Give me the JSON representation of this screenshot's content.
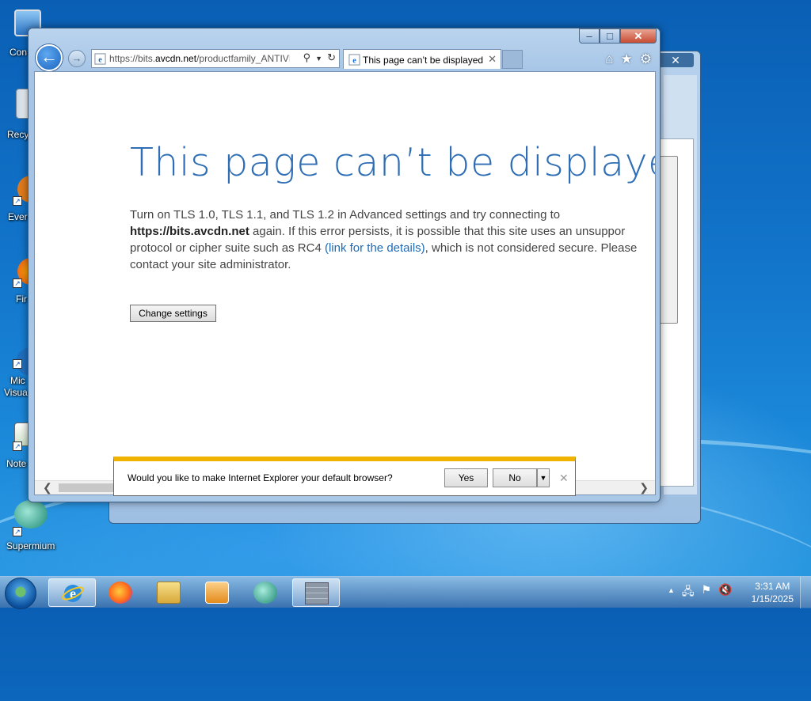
{
  "desktop": {
    "icons": [
      {
        "label": "Con"
      },
      {
        "label": "Recy"
      },
      {
        "label": "Ever"
      },
      {
        "label": "Fir"
      },
      {
        "label": "Mic"
      },
      {
        "label": "Visua"
      },
      {
        "label": "Note"
      },
      {
        "label": "Supermium"
      }
    ]
  },
  "browser": {
    "address_prefix": "https://bits.",
    "address_domain": "avcdn.net",
    "address_suffix": "/productfamily_ANTIVI",
    "tab_title": "This page can’t be displayed",
    "caption": {
      "minimize": "–",
      "maximize": "□",
      "close": "✕"
    },
    "back_symbol": "←",
    "forward_symbol": "→",
    "tab_close": "✕",
    "toolbar_icons": {
      "home": "⌂",
      "favorites": "★",
      "tools": "⚙"
    }
  },
  "error_page": {
    "heading": "This page can’t be displayed",
    "line1": "Turn on TLS 1.0, TLS 1.1, and TLS 1.2 in Advanced settings and try connecting to",
    "host": "https://bits.avcdn.net",
    "line2_rest": " again. If this error persists, it is possible that this site uses an unsuppor",
    "line3_start": "protocol or cipher suite such as RC4 ",
    "link_text": "(link for the details)",
    "line3_end": ", which is not considered secure. Please",
    "line4": "contact your site administrator.",
    "change_settings_button": "Change settings"
  },
  "notification": {
    "text": "Would you like to make Internet Explorer your default browser?",
    "yes": "Yes",
    "no": "No",
    "dropdown": "▼",
    "close": "✕"
  },
  "background_window": {
    "close": "✕"
  },
  "taskbar": {
    "clock_time": "3:31 AM",
    "clock_date": "1/15/2025",
    "tray_expand": "▲"
  },
  "colors": {
    "heading": "#2f6eb4",
    "link": "#1e6bb8",
    "notification_accent": "#f0b400"
  }
}
